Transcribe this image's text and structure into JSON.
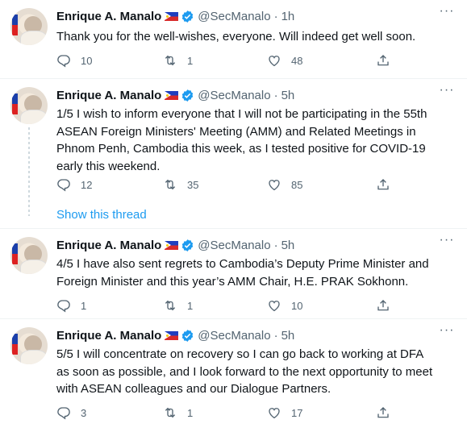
{
  "tweets": [
    {
      "name": "Enrique A. Manalo",
      "handle": "@SecManalo",
      "dot": "·",
      "time": "1h",
      "text": "Thank you for the well-wishes, everyone. Will indeed get well soon.",
      "replies": "10",
      "retweets": "1",
      "likes": "48"
    },
    {
      "name": "Enrique A. Manalo",
      "handle": "@SecManalo",
      "dot": "·",
      "time": "5h",
      "text": "1/5 I wish to inform everyone that I will not be participating in the 55th ASEAN Foreign Ministers' Meeting (AMM) and Related Meetings in Phnom Penh, Cambodia this week, as I tested positive for COVID-19 early this weekend.",
      "replies": "12",
      "retweets": "35",
      "likes": "85"
    },
    {
      "name": "Enrique A. Manalo",
      "handle": "@SecManalo",
      "dot": "·",
      "time": "5h",
      "text": "4/5 I have also sent regrets to Cambodia’s Deputy Prime Minister and Foreign Minister and this year’s AMM Chair, H.E. PRAK Sokhonn.",
      "replies": "1",
      "retweets": "1",
      "likes": "10"
    },
    {
      "name": "Enrique A. Manalo",
      "handle": "@SecManalo",
      "dot": "·",
      "time": "5h",
      "text": "5/5 I will concentrate on recovery so I can go back to working at DFA as soon as possible, and I look forward to the next opportunity to meet with ASEAN colleagues and our  Dialogue Partners.",
      "replies": "3",
      "retweets": "1",
      "likes": "17"
    }
  ],
  "show_thread": "Show this thread",
  "more_label": "···",
  "colors": {
    "link": "#1d9bf0",
    "muted": "#536471",
    "text": "#0f1419"
  }
}
